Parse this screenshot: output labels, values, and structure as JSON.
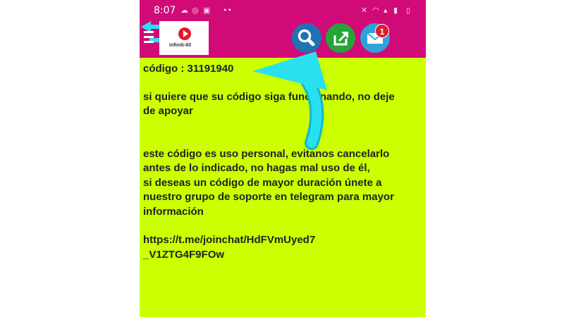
{
  "status_bar": {
    "time": "8:07"
  },
  "app": {
    "logo_text": "infiniti-60",
    "notification_count": "1"
  },
  "content": {
    "code_line": "código : 31191940",
    "support_line": "si quiere que su código siga funcionando, no deje\nde apoyar",
    "info_line": "este código es uso personal, evitanos cancelarlo\nantes de lo indicado, no hagas mal uso de él,\nsi deseas un código de mayor duración únete a\nnuestro grupo de soporte en telegram para mayor\ninformación",
    "link": "https://t.me/joinchat/HdFVmUyed7\n_V1ZTG4F9FOw"
  },
  "icons": {
    "menu": "hamburger-icon",
    "search": "search-icon",
    "share": "share-icon",
    "mail": "mail-icon",
    "back": "back-arrow-icon"
  },
  "colors": {
    "app_bar": "#d10a78",
    "content_background": "#ccff00",
    "search_button": "#1f72b3",
    "share_button": "#27a338",
    "mail_button": "#2fa3d8",
    "badge": "#e21b2a",
    "tutorial_arrow": "#29e0f0"
  }
}
